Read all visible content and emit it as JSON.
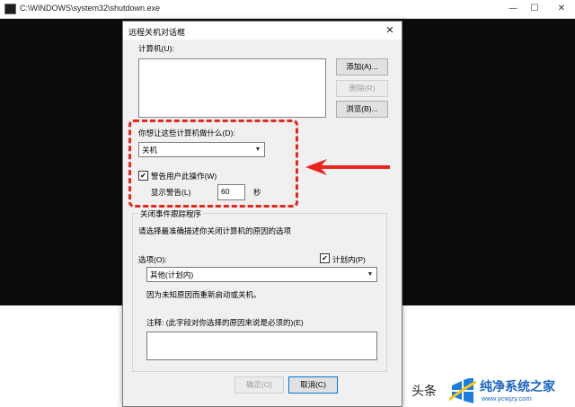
{
  "console": {
    "title": "C:\\WINDOWS\\system32\\shutdown.exe",
    "controls": {
      "minimize": "—",
      "maximize": "☐",
      "close": "✕"
    }
  },
  "dialog": {
    "title": "远程关机对话框",
    "close": "✕",
    "computers_label": "计算机(U):",
    "add_button": "添加(A)...",
    "delete_button": "删除(R)",
    "browse_button": "浏览(B)...",
    "action_label": "你想让这些计算机做什么(D):",
    "action_value": "关机",
    "warn_checkbox_label": "警告用户此操作(W)",
    "warn_checked": true,
    "display_warning_label": "显示警告(L)",
    "warning_seconds": "60",
    "seconds_unit": "秒",
    "tracker": {
      "legend": "关闭事件跟踪程序",
      "instruction": "请选择最准确描述你关闭计算机的原因的选项",
      "options_label": "选项(O):",
      "planned_label": "计划内(P)",
      "planned_checked": true,
      "option_value": "其他(计划内)",
      "description": "因为未知原因而重新启动或关机。",
      "comment_label": "注释: (此字段对你选择的原因来说是必须的)(E)"
    },
    "ok_button": "确定(O)",
    "cancel_button": "取消(C)"
  },
  "annotation": {
    "color": "#e8251f"
  },
  "watermark": {
    "left_text": "头条",
    "brand": "纯净系统之家",
    "url": "www.ycwjzy.com"
  }
}
